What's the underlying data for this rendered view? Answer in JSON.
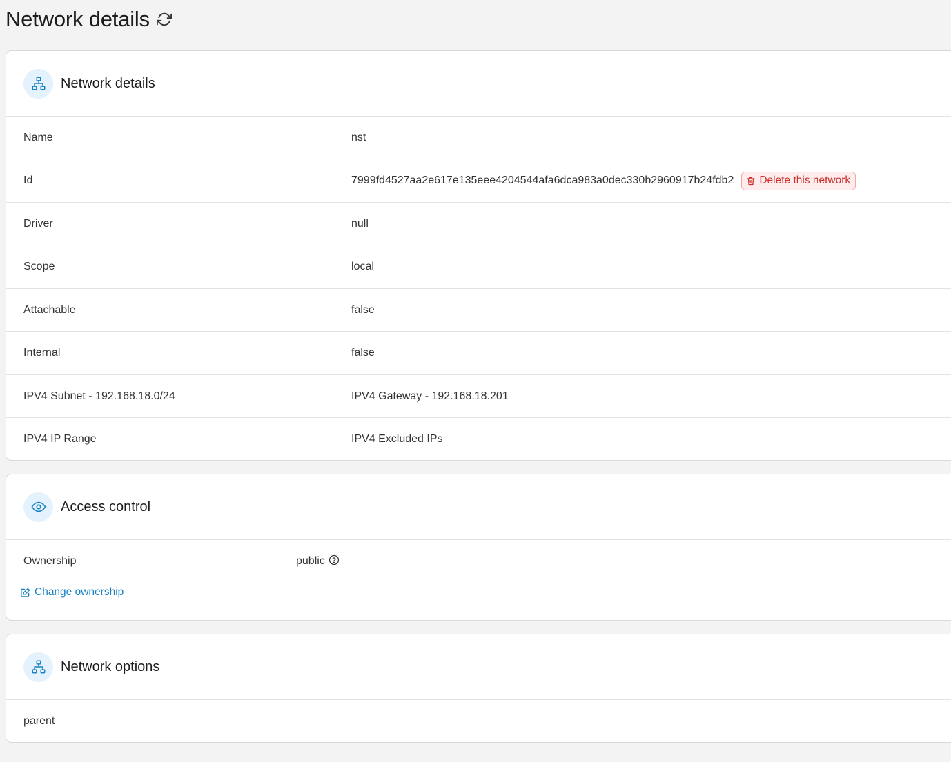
{
  "page": {
    "title": "Network details",
    "refresh_icon": "refresh-icon"
  },
  "network_details": {
    "title": "Network details",
    "icon": "sitemap-icon",
    "rows": [
      {
        "label": "Name",
        "value": "nst"
      },
      {
        "label": "Id",
        "value": "7999fd4527aa2e617e135eee4204544afa6dca983a0dec330b2960917b24fdb2"
      },
      {
        "label": "Driver",
        "value": "null"
      },
      {
        "label": "Scope",
        "value": "local"
      },
      {
        "label": "Attachable",
        "value": "false"
      },
      {
        "label": "Internal",
        "value": "false"
      },
      {
        "label": "IPV4 Subnet - 192.168.18.0/24",
        "value": "IPV4 Gateway - 192.168.18.201"
      },
      {
        "label": "IPV4 IP Range",
        "value": "IPV4 Excluded IPs"
      }
    ],
    "delete_button": "Delete this network",
    "delete_icon": "trash-icon"
  },
  "access_control": {
    "title": "Access control",
    "icon": "eye-icon",
    "ownership_label": "Ownership",
    "ownership_value": "public",
    "help_icon": "question-circle-icon",
    "change_link": "Change ownership",
    "edit_icon": "edit-icon"
  },
  "network_options": {
    "title": "Network options",
    "icon": "sitemap-icon",
    "rows": [
      {
        "label": "parent",
        "value": ""
      }
    ]
  },
  "colors": {
    "accent": "#1a82c4",
    "danger": "#c9302c",
    "danger_bg": "#fdeceb",
    "icon_circle_bg": "#e3f2fc",
    "page_bg": "#f3f3f3"
  }
}
